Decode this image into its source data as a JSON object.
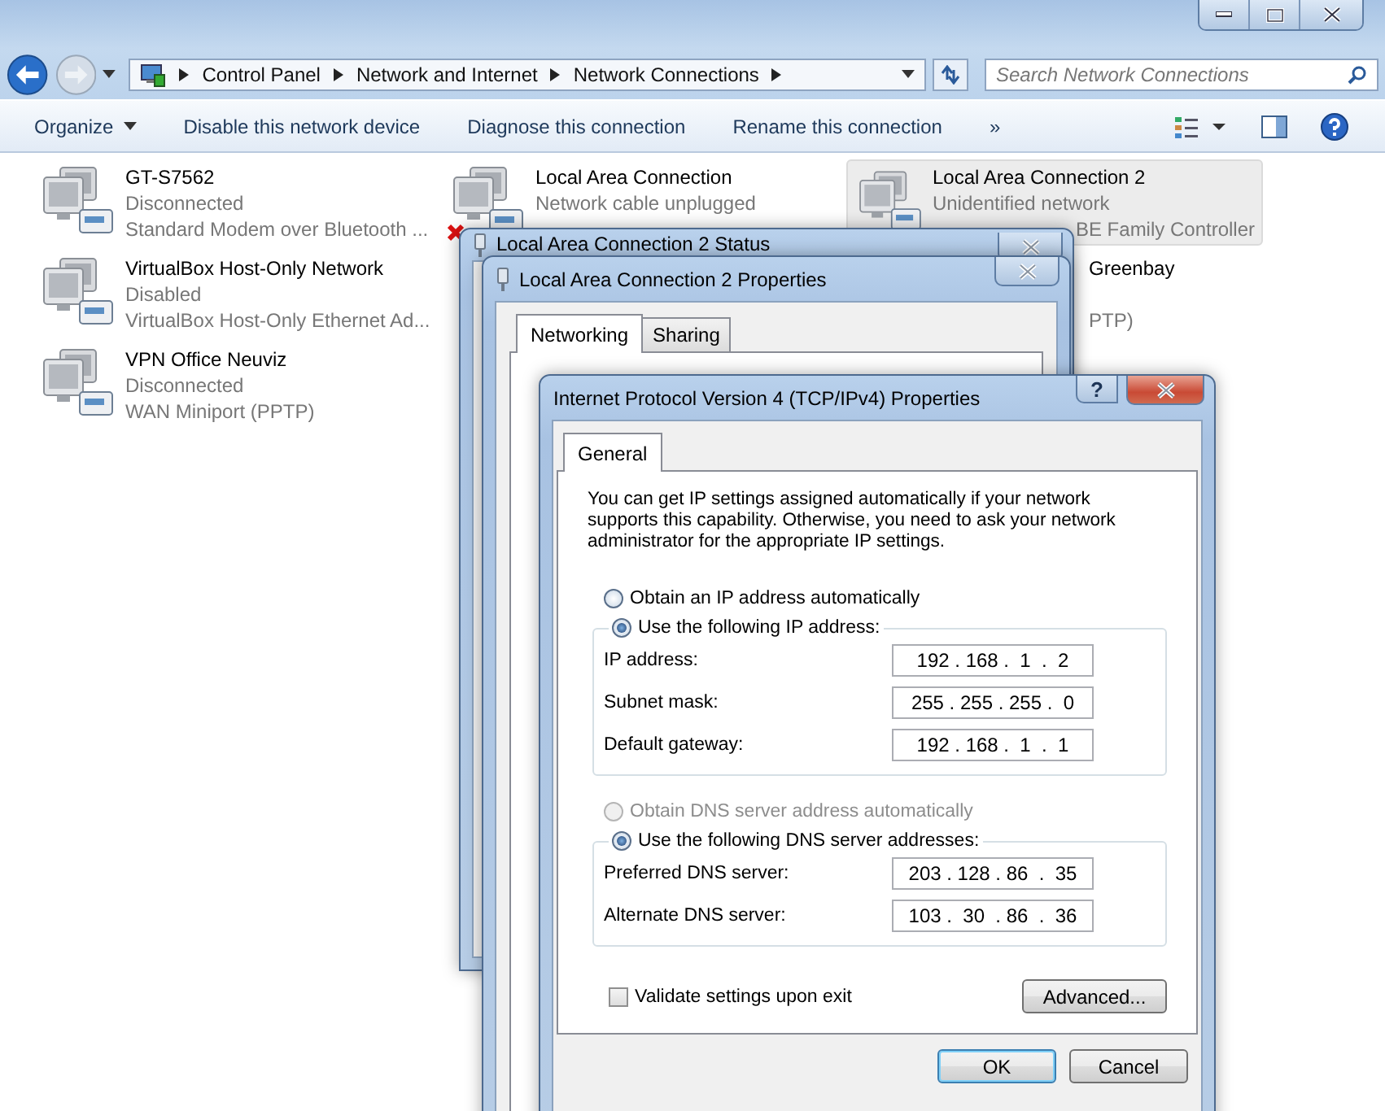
{
  "explorer": {
    "breadcrumb": [
      "Control Panel",
      "Network and Internet",
      "Network Connections"
    ],
    "search": {
      "placeholder": "Search Network Connections"
    },
    "toolbar": [
      {
        "label": "Organize",
        "dropdown": true
      },
      {
        "label": "Disable this network device",
        "dropdown": false
      },
      {
        "label": "Diagnose this connection",
        "dropdown": false
      },
      {
        "label": "Rename this connection",
        "dropdown": false
      }
    ],
    "more": "»",
    "connections": [
      {
        "kind": "full",
        "name": "GT-S7562",
        "status": "Disconnected",
        "device": "Standard Modem over Bluetooth ...",
        "selected": false,
        "error": false
      },
      {
        "kind": "full",
        "name": "Local Area Connection",
        "status": "Network cable unplugged",
        "selected": false,
        "error": true
      },
      {
        "kind": "full",
        "name": "Local Area Connection 2",
        "status": "Unidentified network",
        "device": "BE Family Controller",
        "selected": true,
        "error": false,
        "device_cut": true
      },
      {
        "kind": "full",
        "name": "VirtualBox Host-Only Network",
        "status": "Disabled",
        "device": "VirtualBox Host-Only Ethernet Ad...",
        "selected": false,
        "error": false
      },
      {
        "kind": "cut",
        "name": "Greenbay",
        "device": "PTP)",
        "selected": false
      },
      {
        "kind": "full",
        "name": "VPN Office Neuviz",
        "status": "Disconnected",
        "device": "WAN Miniport (PPTP)",
        "selected": false,
        "error": false
      }
    ]
  },
  "status_window": {
    "title": "Local Area Connection 2 Status",
    "active": false
  },
  "properties_window": {
    "title": "Local Area Connection 2 Properties",
    "active": false,
    "tabs": [
      {
        "label": "Networking",
        "selected": true
      },
      {
        "label": "Sharing",
        "selected": false
      }
    ]
  },
  "ipv4_window": {
    "title": "Internet Protocol Version 4 (TCP/IPv4) Properties",
    "active": true,
    "help": "?",
    "tabs": [
      {
        "label": "General",
        "selected": true
      }
    ],
    "description": "You can get IP settings assigned automatically if your network supports this capability. Otherwise, you need to ask your network administrator for the appropriate IP settings.",
    "ip_options": [
      {
        "label": "Obtain an IP address automatically",
        "selected": false,
        "disabled": false
      },
      {
        "label": "Use the following IP address:",
        "selected": true,
        "disabled": false
      }
    ],
    "ip_fields": [
      {
        "label": "IP address:",
        "value": "192 . 168 .  1  .  2"
      },
      {
        "label": "Subnet mask:",
        "value": "255 . 255 . 255 .  0"
      },
      {
        "label": "Default gateway:",
        "value": "192 . 168 .  1  .  1"
      }
    ],
    "dns_options": [
      {
        "label": "Obtain DNS server address automatically",
        "selected": false,
        "disabled": true
      },
      {
        "label": "Use the following DNS server addresses:",
        "selected": true,
        "disabled": false
      }
    ],
    "dns_fields": [
      {
        "label": "Preferred DNS server:",
        "value": "203 . 128 . 86  .  35"
      },
      {
        "label": "Alternate DNS server:",
        "value": "103 .  30  . 86  .  36"
      }
    ],
    "validate": {
      "label": "Validate settings upon exit",
      "checked": false
    },
    "advanced": "Advanced...",
    "buttons": [
      {
        "label": "OK",
        "default": true
      },
      {
        "label": "Cancel",
        "default": false
      }
    ]
  }
}
